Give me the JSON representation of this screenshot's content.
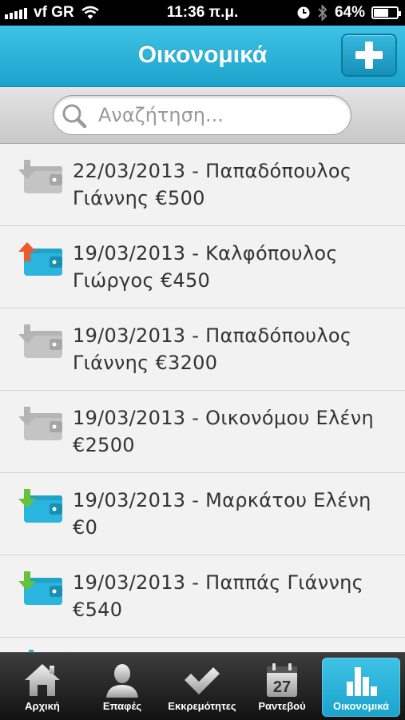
{
  "status_bar": {
    "carrier": "vf GR",
    "time": "11:36 π.μ.",
    "battery_percent": "64%",
    "battery_level": 0.64
  },
  "header": {
    "title": "Οικονομικά",
    "add_icon": "plus-icon"
  },
  "search": {
    "placeholder": "Αναζήτηση...",
    "value": ""
  },
  "colors": {
    "accent": "#29b5de",
    "arrow_in": "#66c23a",
    "arrow_out": "#ef5a2a",
    "wallet_active": "#29b5de",
    "wallet_inactive": "#c4c4c4"
  },
  "transactions": [
    {
      "line1": "22/03/2013 - Παπαδόπουλος",
      "line2": "Γιάννης €500",
      "direction": "in",
      "status": "inactive"
    },
    {
      "line1": "19/03/2013 - Καλφόπουλος",
      "line2": "Γιώργος €450",
      "direction": "out",
      "status": "active"
    },
    {
      "line1": "19/03/2013 - Παπαδόπουλος",
      "line2": "Γιάννης €3200",
      "direction": "in",
      "status": "inactive"
    },
    {
      "line1": "19/03/2013 - Οικονόμου Ελένη",
      "line2": "€2500",
      "direction": "in",
      "status": "inactive"
    },
    {
      "line1": "19/03/2013 - Μαρκάτου Ελένη",
      "line2": "€0",
      "direction": "in",
      "status": "active"
    },
    {
      "line1": "19/03/2013 - Παππάς Γιάννης",
      "line2": "€540",
      "direction": "in",
      "status": "active"
    }
  ],
  "tabs": [
    {
      "label": "Αρχική",
      "icon": "home-icon"
    },
    {
      "label": "Επαφές",
      "icon": "person-icon"
    },
    {
      "label": "Εκκρεμότητες",
      "icon": "checkmark-icon"
    },
    {
      "label": "Ραντεβού",
      "icon": "calendar-icon",
      "calendar_day": "27"
    },
    {
      "label": "Οικονομικά",
      "icon": "bar-chart-icon",
      "active": true
    }
  ]
}
